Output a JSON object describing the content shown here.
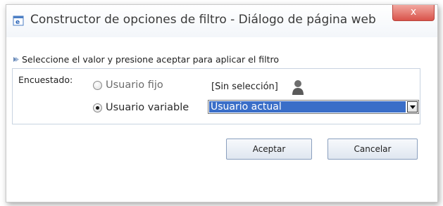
{
  "dialog": {
    "title": "Constructor de opciones de filtro - Diálogo de página web",
    "close_label": "x"
  },
  "instruction": "Seleccione el valor y presione aceptar para aplicar el filtro",
  "form": {
    "field_label": "Encuestado:",
    "options": [
      {
        "label": "Usuario fijo",
        "checked": false
      },
      {
        "label": "Usuario variable",
        "checked": true
      }
    ],
    "fixed_user_value": "[Sin selección]",
    "variable_user_select": {
      "selected": "Usuario actual"
    }
  },
  "buttons": {
    "ok": "Aceptar",
    "cancel": "Cancelar"
  },
  "colors": {
    "select_highlight": "#3a6ec8",
    "close_button": "#d9534a"
  },
  "icons": [
    "web-page-icon",
    "close-icon",
    "bullet-icon",
    "person-icon",
    "dropdown-arrow-icon"
  ]
}
